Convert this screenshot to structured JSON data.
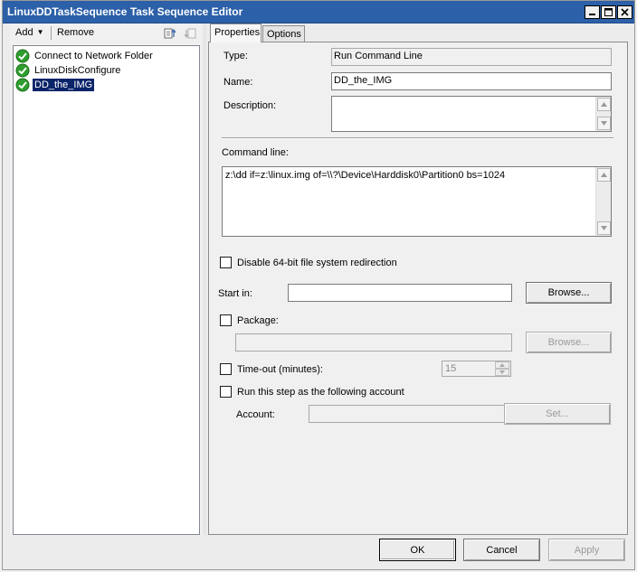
{
  "window": {
    "title": "LinuxDDTaskSequence Task Sequence Editor"
  },
  "toolbar": {
    "add_label": "Add",
    "remove_label": "Remove"
  },
  "tree": {
    "items": [
      {
        "label": "Connect to Network Folder",
        "status": "success-check",
        "selected": false
      },
      {
        "label": "LinuxDiskConfigure",
        "status": "success-check",
        "selected": false
      },
      {
        "label": "DD_the_IMG",
        "status": "success-check",
        "selected": true
      }
    ]
  },
  "tabs": [
    {
      "label": "Properties",
      "active": true
    },
    {
      "label": "Options",
      "active": false
    }
  ],
  "properties": {
    "type_label": "Type:",
    "type_value": "Run Command Line",
    "name_label": "Name:",
    "name_value": "DD_the_IMG",
    "description_label": "Description:",
    "description_value": "",
    "command_line_label": "Command line:",
    "command_line_value": "z:\\dd if=z:\\linux.img of=\\\\?\\Device\\Harddisk0\\Partition0 bs=1024",
    "disable_redirect_label": "Disable 64-bit file system redirection",
    "disable_redirect_checked": false,
    "start_in_label": "Start in:",
    "start_in_value": "",
    "browse_label": "Browse...",
    "package_label": "Package:",
    "package_checked": false,
    "package_value": "",
    "package_browse_label": "Browse...",
    "timeout_label": "Time-out (minutes):",
    "timeout_checked": false,
    "timeout_value": "15",
    "run_as_label": "Run this step as the following account",
    "run_as_checked": false,
    "account_label": "Account:",
    "account_value": "",
    "set_label": "Set..."
  },
  "footer": {
    "ok_label": "OK",
    "cancel_label": "Cancel",
    "apply_label": "Apply"
  },
  "colors": {
    "titlebar": "#2c60a8",
    "selection": "#0a246a",
    "success_icon": "#2e9e2e"
  }
}
